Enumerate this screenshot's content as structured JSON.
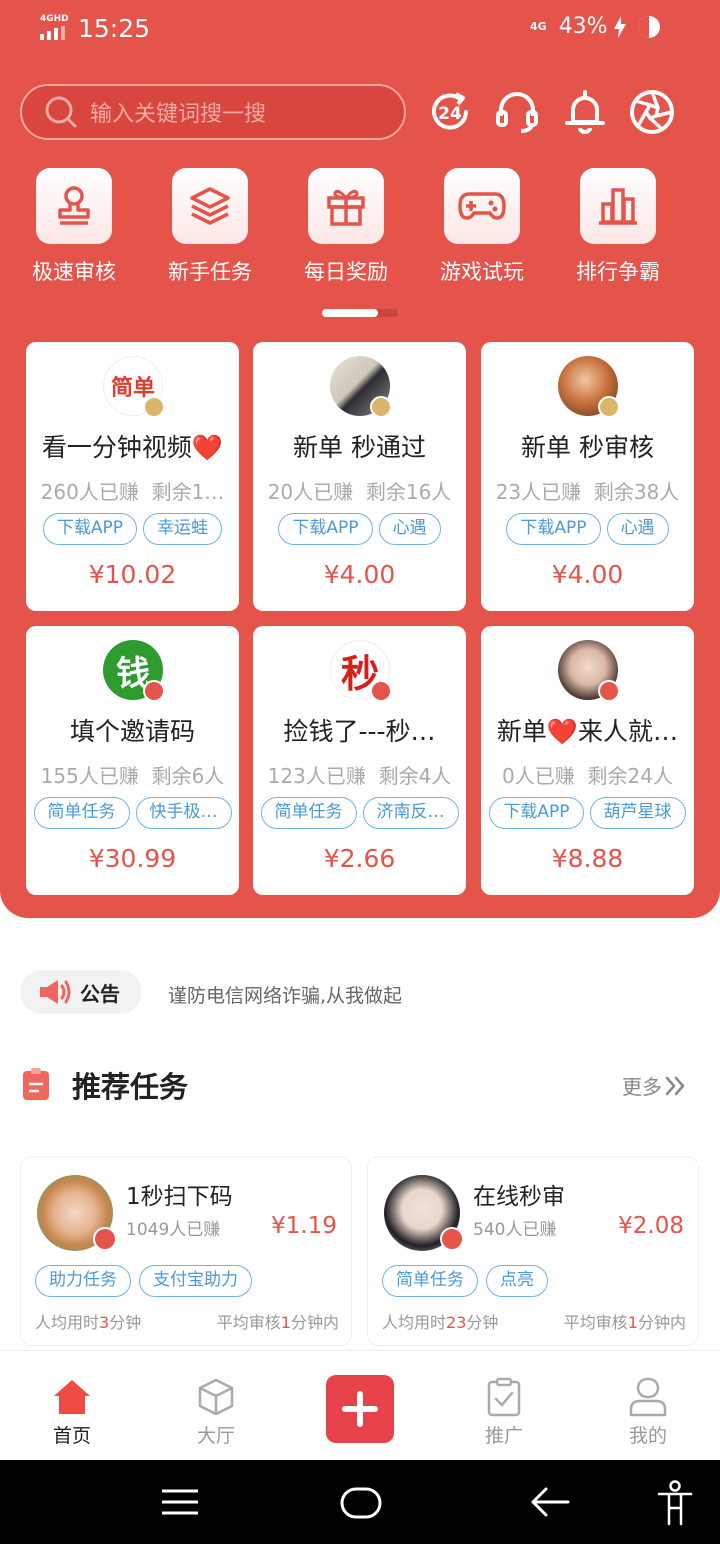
{
  "status_bar": {
    "network": "4GHD",
    "time": "15:25",
    "lte": "4G",
    "battery": "43%"
  },
  "search": {
    "placeholder": "输入关键词搜一搜"
  },
  "quick_menu": [
    {
      "label": "极速审核",
      "icon": "stamp-icon"
    },
    {
      "label": "新手任务",
      "icon": "layers-icon"
    },
    {
      "label": "每日奖励",
      "icon": "gift-icon"
    },
    {
      "label": "游戏试玩",
      "icon": "gamepad-icon"
    },
    {
      "label": "排行争霸",
      "icon": "bar-chart-icon"
    }
  ],
  "tasks": [
    {
      "title": "看一分钟视频❤️",
      "earned": "260人已赚",
      "remaining": "剩余1…",
      "tags": [
        "下载APP",
        "幸运蛙"
      ],
      "price": "¥10.02",
      "avatar_text": "简单"
    },
    {
      "title": "新单 秒通过",
      "earned": "20人已赚",
      "remaining": "剩余16人",
      "tags": [
        "下载APP",
        "心遇"
      ],
      "price": "¥4.00"
    },
    {
      "title": "新单 秒审核",
      "earned": "23人已赚",
      "remaining": "剩余38人",
      "tags": [
        "下载APP",
        "心遇"
      ],
      "price": "¥4.00"
    },
    {
      "title": "填个邀请码",
      "earned": "155人已赚",
      "remaining": "剩余6人",
      "tags": [
        "简单任务",
        "快手极…"
      ],
      "price": "¥30.99",
      "avatar_text": "钱"
    },
    {
      "title": "捡钱了---秒…",
      "earned": "123人已赚",
      "remaining": "剩余4人",
      "tags": [
        "简单任务",
        "济南反…"
      ],
      "price": "¥2.66",
      "avatar_text": "秒"
    },
    {
      "title": "新单❤️来人就…",
      "earned": "0人已赚",
      "remaining": "剩余24人",
      "tags": [
        "下载APP",
        "葫芦星球"
      ],
      "price": "¥8.88"
    }
  ],
  "notice": {
    "label": "公告",
    "text": "谨防电信网络诈骗,从我做起"
  },
  "recommend": {
    "title": "推荐任务",
    "more": "更多",
    "items": [
      {
        "name": "1秒扫下码",
        "earned": "1049人已赚",
        "price": "¥1.19",
        "tags": [
          "助力任务",
          "支付宝助力"
        ],
        "avg_time_pre": "人均用时",
        "avg_time_val": "3",
        "avg_time_post": "分钟",
        "avg_review_pre": "平均审核",
        "avg_review_val": "1",
        "avg_review_post": "分钟内"
      },
      {
        "name": "在线秒审",
        "earned": "540人已赚",
        "price": "¥2.08",
        "tags": [
          "简单任务",
          "点亮"
        ],
        "avg_time_pre": "人均用时",
        "avg_time_val": "23",
        "avg_time_post": "分钟",
        "avg_review_pre": "平均审核",
        "avg_review_val": "1",
        "avg_review_post": "分钟内"
      }
    ]
  },
  "bottom_nav": [
    {
      "label": "首页",
      "icon": "home-icon",
      "active": true
    },
    {
      "label": "大厅",
      "icon": "cube-icon"
    },
    {
      "label": "",
      "icon": "plus-icon"
    },
    {
      "label": "推广",
      "icon": "clipboard-check-icon"
    },
    {
      "label": "我的",
      "icon": "user-icon"
    }
  ],
  "colors": {
    "brand_red": "#e5544b",
    "tag_blue": "#4a9ad6",
    "price_red": "#e5544b"
  }
}
